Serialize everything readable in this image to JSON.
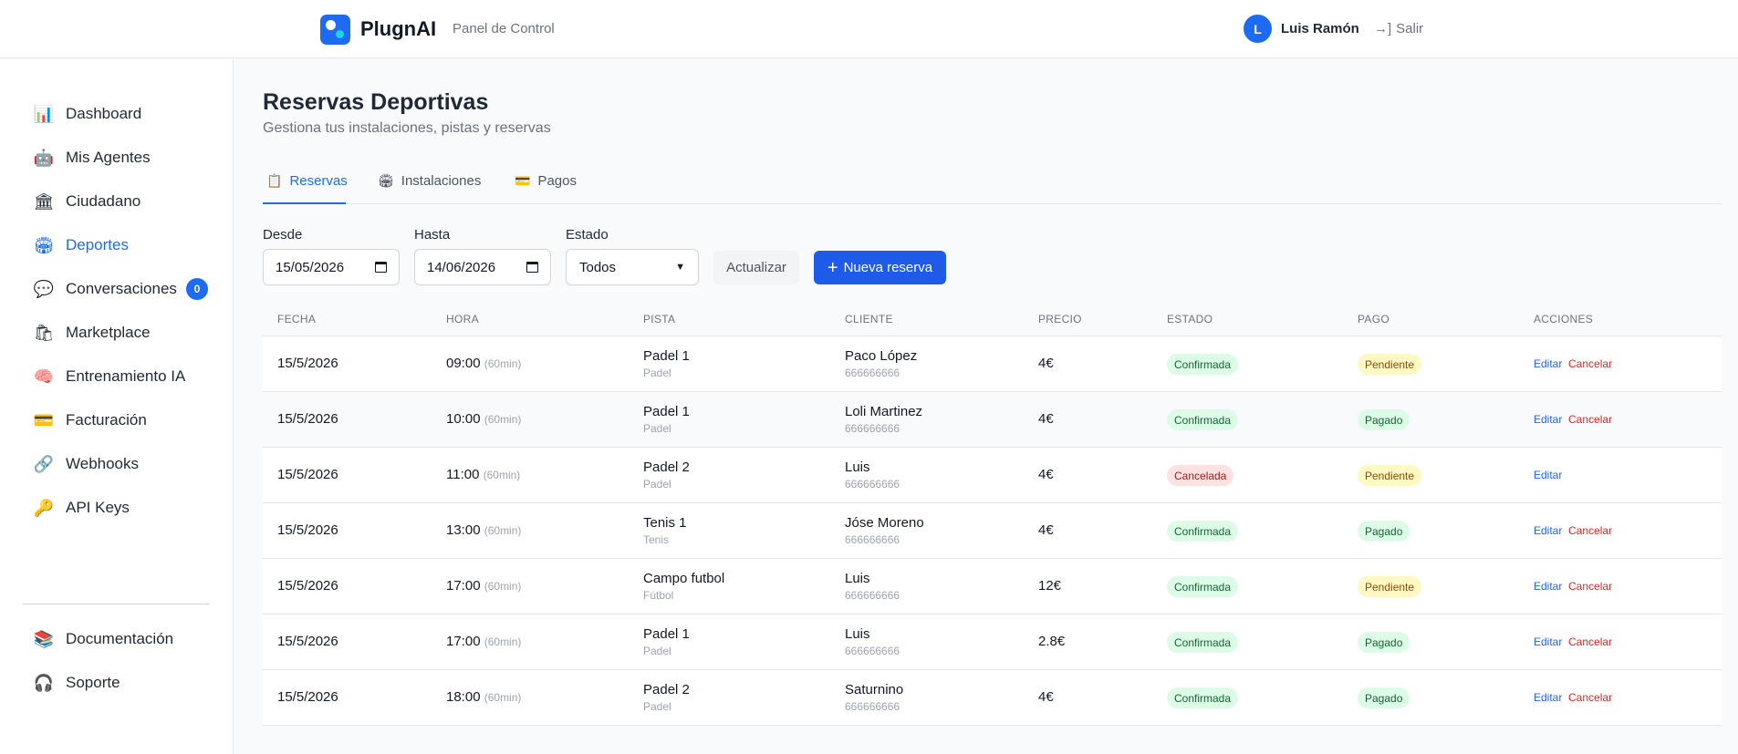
{
  "header": {
    "brand": "PlugnAI",
    "panel_label": "Panel de Control",
    "avatar_initial": "L",
    "user_name": "Luis Ramón",
    "logout_icon": "→]",
    "logout_label": "Salir"
  },
  "sidebar": {
    "items": [
      {
        "label": "Dashboard",
        "icon": "📊"
      },
      {
        "label": "Mis Agentes",
        "icon": "🤖"
      },
      {
        "label": "Ciudadano",
        "icon": "🏛"
      },
      {
        "label": "Deportes",
        "icon": "🏟"
      },
      {
        "label": "Conversaciones",
        "icon": "💬",
        "badge": "0"
      },
      {
        "label": "Marketplace",
        "icon": "🛍"
      },
      {
        "label": "Entrenamiento IA",
        "icon": "🧠"
      },
      {
        "label": "Facturación",
        "icon": "💳"
      },
      {
        "label": "Webhooks",
        "icon": "🔗"
      },
      {
        "label": "API Keys",
        "icon": "🔑"
      }
    ],
    "footer_items": [
      {
        "label": "Documentación",
        "icon": "📚"
      },
      {
        "label": "Soporte",
        "icon": "🎧"
      }
    ],
    "active": "Deportes"
  },
  "page": {
    "title": "Reservas Deportivas",
    "subtitle": "Gestiona tus instalaciones, pistas y reservas"
  },
  "tabs": [
    {
      "label": "Reservas",
      "icon": "📋"
    },
    {
      "label": "Instalaciones",
      "icon": "🏟"
    },
    {
      "label": "Pagos",
      "icon": "💳"
    }
  ],
  "filters": {
    "from_label": "Desde",
    "from_value": "15/05/2026",
    "to_label": "Hasta",
    "to_value": "14/06/2026",
    "status_label": "Estado",
    "status_value": "Todos",
    "refresh_label": "Actualizar",
    "new_label": "Nueva reserva"
  },
  "table": {
    "headers": [
      "FECHA",
      "HORA",
      "PISTA",
      "CLIENTE",
      "PRECIO",
      "ESTADO",
      "PAGO",
      "ACCIONES"
    ],
    "edit_label": "Editar",
    "cancel_label": "Cancelar",
    "rows": [
      {
        "fecha": "15/5/2026",
        "hora": "09:00",
        "duracion": "(60min)",
        "pista": "Padel 1",
        "tipo": "Padel",
        "cliente": "Paco López",
        "telefono": "666666666",
        "precio": "4€",
        "estado": "Confirmada",
        "pago": "Pendiente",
        "cancelable": true
      },
      {
        "fecha": "15/5/2026",
        "hora": "10:00",
        "duracion": "(60min)",
        "pista": "Padel 1",
        "tipo": "Padel",
        "cliente": "Loli Martinez",
        "telefono": "666666666",
        "precio": "4€",
        "estado": "Confirmada",
        "pago": "Pagado",
        "cancelable": true
      },
      {
        "fecha": "15/5/2026",
        "hora": "11:00",
        "duracion": "(60min)",
        "pista": "Padel 2",
        "tipo": "Padel",
        "cliente": "Luis",
        "telefono": "666666666",
        "precio": "4€",
        "estado": "Cancelada",
        "pago": "Pendiente",
        "cancelable": false
      },
      {
        "fecha": "15/5/2026",
        "hora": "13:00",
        "duracion": "(60min)",
        "pista": "Tenis 1",
        "tipo": "Tenis",
        "cliente": "Jóse Moreno",
        "telefono": "666666666",
        "precio": "4€",
        "estado": "Confirmada",
        "pago": "Pagado",
        "cancelable": true
      },
      {
        "fecha": "15/5/2026",
        "hora": "17:00",
        "duracion": "(60min)",
        "pista": "Campo futbol",
        "tipo": "Fútbol",
        "cliente": "Luis",
        "telefono": "666666666",
        "precio": "12€",
        "estado": "Confirmada",
        "pago": "Pendiente",
        "cancelable": true
      },
      {
        "fecha": "15/5/2026",
        "hora": "17:00",
        "duracion": "(60min)",
        "pista": "Padel 1",
        "tipo": "Padel",
        "cliente": "Luis",
        "telefono": "666666666",
        "precio": "2.8€",
        "estado": "Confirmada",
        "pago": "Pagado",
        "cancelable": true
      },
      {
        "fecha": "15/5/2026",
        "hora": "18:00",
        "duracion": "(60min)",
        "pista": "Padel 2",
        "tipo": "Padel",
        "cliente": "Saturnino",
        "telefono": "666666666",
        "precio": "4€",
        "estado": "Confirmada",
        "pago": "Pagado",
        "cancelable": true
      }
    ]
  },
  "colors": {
    "accent": "#1d6bf3",
    "primary_button": "#1d5be8",
    "ok_bg": "#dcfce7",
    "ok_fg": "#166534",
    "warn_bg": "#fef9c3",
    "warn_fg": "#854d0e",
    "bad_bg": "#fee2e2",
    "bad_fg": "#991b1b"
  }
}
